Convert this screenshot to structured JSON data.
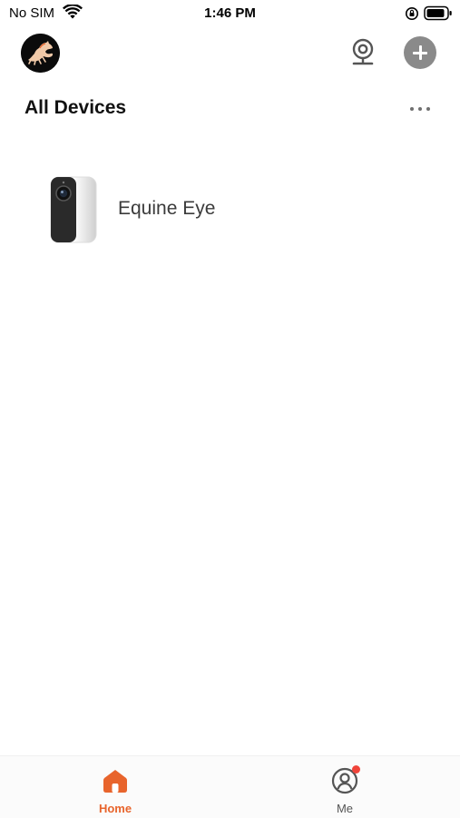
{
  "status_bar": {
    "carrier": "No SIM",
    "time": "1:46 PM"
  },
  "header": {
    "avatar_icon": "horse-logo-icon",
    "camera_icon": "webcam-icon",
    "add_icon": "plus-icon"
  },
  "main": {
    "section_title": "All Devices",
    "more_icon": "ellipsis-icon",
    "devices": [
      {
        "name": "Equine Eye",
        "icon": "camera-device-icon"
      }
    ]
  },
  "tab_bar": {
    "tabs": [
      {
        "label": "Home",
        "icon": "home-icon",
        "active": true
      },
      {
        "label": "Me",
        "icon": "profile-icon",
        "active": false,
        "badge": true
      }
    ]
  },
  "colors": {
    "accent": "#e8642c",
    "badge": "#f0443a",
    "add_button": "#8a8a8a"
  }
}
